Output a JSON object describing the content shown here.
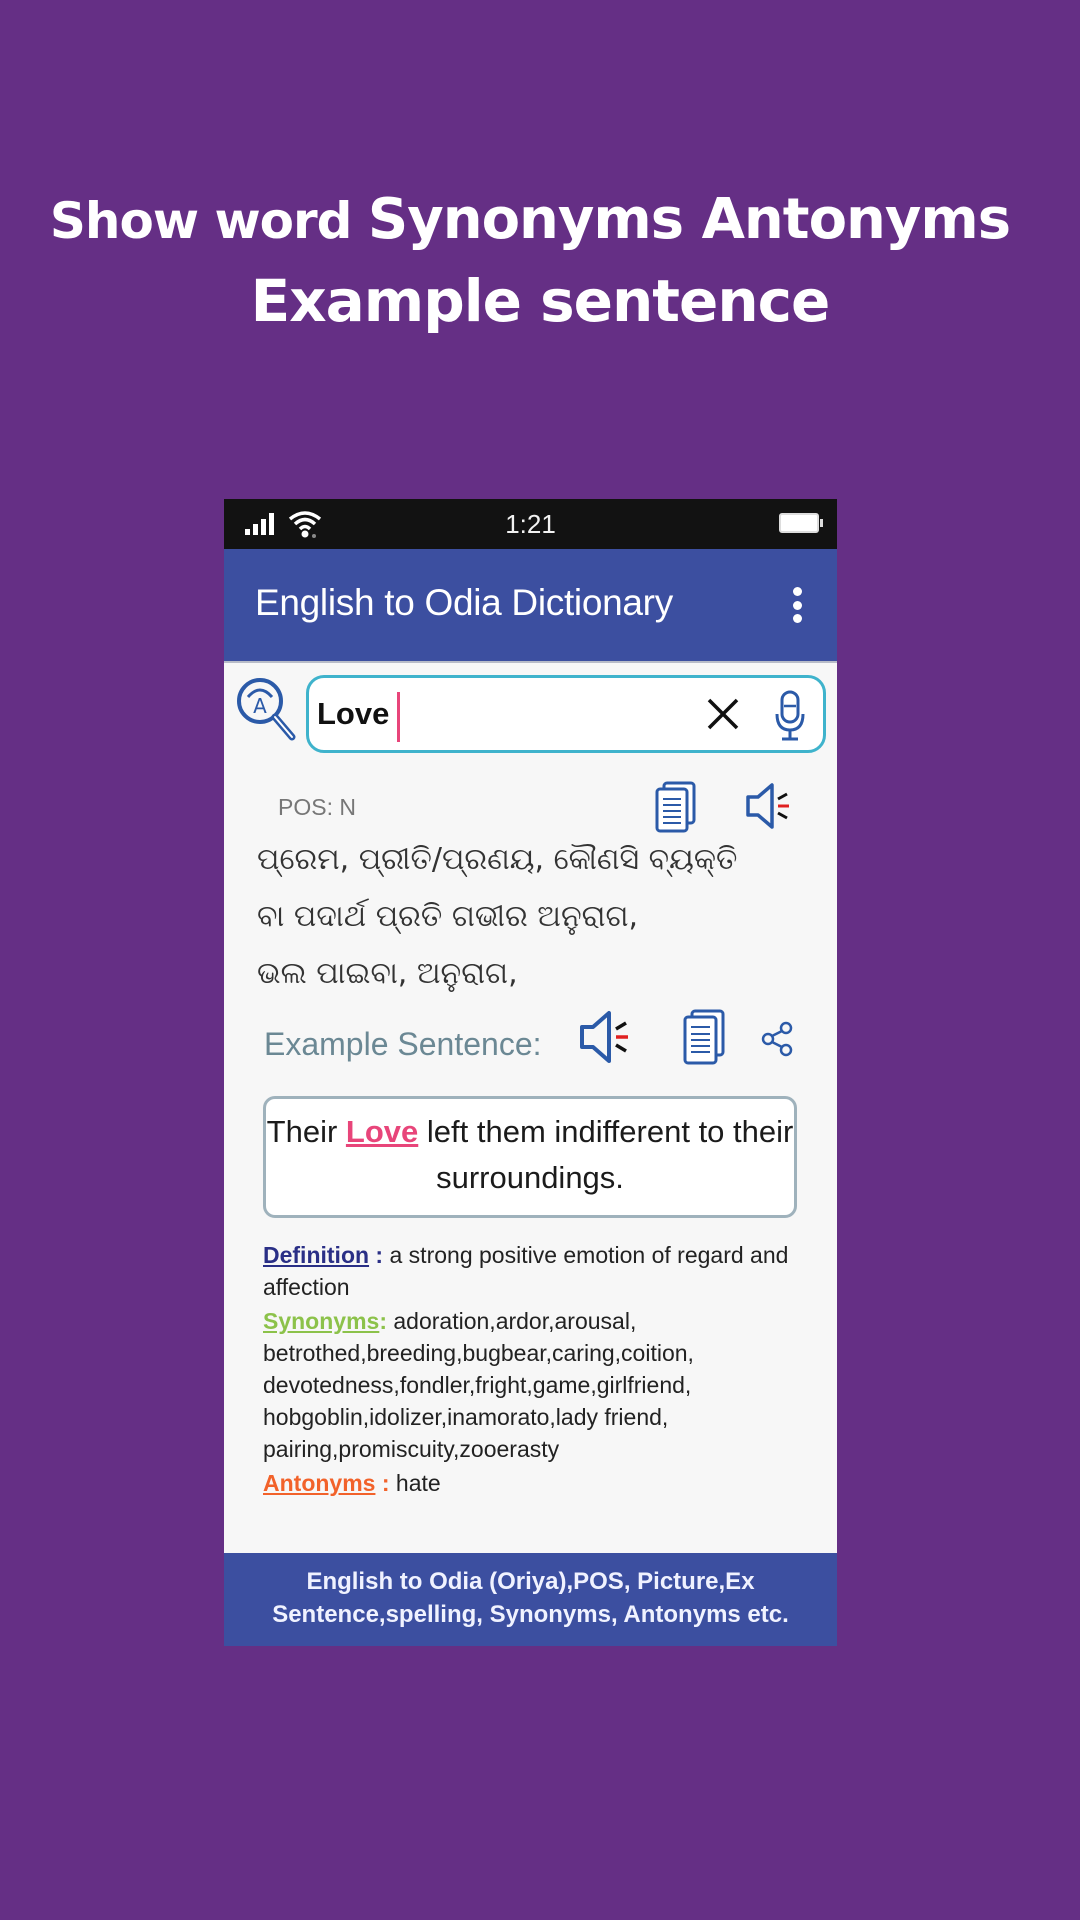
{
  "headline": {
    "line1_prefix": "Show word ",
    "line1_big": "Synonyms Antonyms",
    "line2": "Example sentence"
  },
  "status_bar": {
    "time": "1:21",
    "icons": [
      "signal-icon",
      "wifi-icon",
      "battery-icon"
    ]
  },
  "app_bar": {
    "title": "English to Odia Dictionary",
    "menu_icon": "more-vert-icon"
  },
  "search": {
    "value": "Love",
    "placeholder": "",
    "clear_icon": "close-icon",
    "mic_icon": "microphone-icon",
    "dict_icon": "dictionary-search-icon"
  },
  "result": {
    "pos": "POS: N",
    "odia_lines": [
      "ପ୍ରେମ, ପ୍ରୀତି/ପ୍ରଣୟ, କୌଣସି ବ୍ୟକ୍ତି",
      "ବା ପଦାର୍ଥ ପ୍ରତି ଗଭୀର ଅନୁରାଗ,",
      "ଭଲ ପାଇବା,  ଅନୁରାଗ,"
    ]
  },
  "example": {
    "label": "Example Sentence:",
    "before": "Their ",
    "highlight": "Love",
    "after": " left them indifferent to their surroundings."
  },
  "details": {
    "definition_label": "Definition",
    "definition_colon": " :",
    "definition": " a strong positive emotion of regard and affection",
    "synonyms_label": "Synonyms",
    "synonyms_colon": ":",
    "synonyms": " adoration,ardor,arousal, betrothed,breeding,bugbear,caring,coition, devotedness,fondler,fright,game,girlfriend, hobgoblin,idolizer,inamorato,lady friend, pairing,promiscuity,zooerasty",
    "antonyms_label": "Antonyms",
    "antonyms_colon": " :",
    "antonyms": " hate"
  },
  "banner": {
    "line1": "English to Odia (Oriya),POS, Picture,Ex",
    "line2": "Sentence,spelling, Synonyms, Antonyms etc."
  },
  "colors": {
    "background": "#652f85",
    "app_bar": "#3c4fa0",
    "search_border": "#3fb3cc",
    "highlight": "#e8457a",
    "definition": "#2a2f86",
    "synonyms": "#8cc24a",
    "antonyms": "#f2622a"
  }
}
